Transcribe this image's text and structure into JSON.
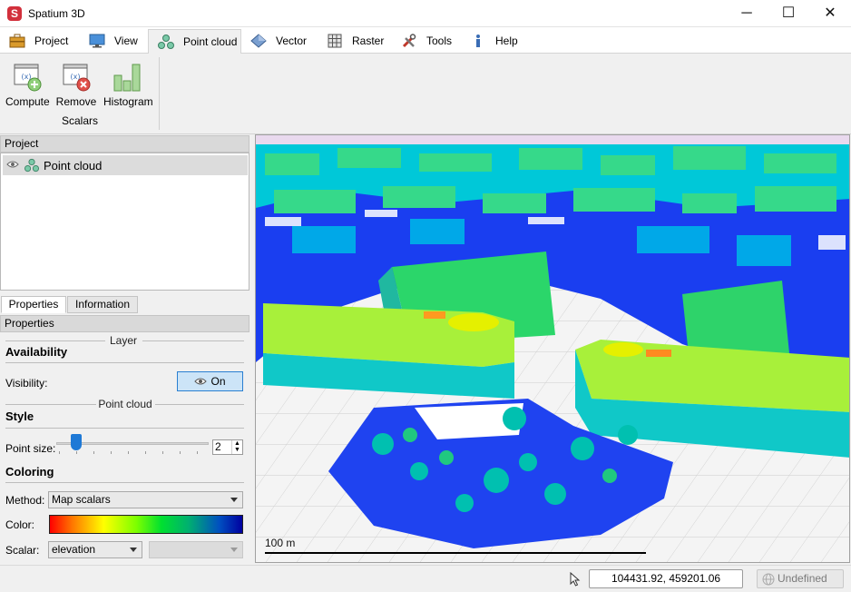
{
  "app": {
    "title": "Spatium 3D",
    "logo_letter": "S"
  },
  "window_controls": {
    "minimize": "─",
    "maximize": "☐",
    "close": "✕"
  },
  "tabs": [
    {
      "label": "Project",
      "icon": "briefcase-icon"
    },
    {
      "label": "View",
      "icon": "monitor-icon"
    },
    {
      "label": "Point cloud",
      "icon": "point-cloud-icon",
      "active": true
    },
    {
      "label": "Vector",
      "icon": "vector-diamond-icon"
    },
    {
      "label": "Raster",
      "icon": "raster-grid-icon"
    },
    {
      "label": "Tools",
      "icon": "tools-icon"
    },
    {
      "label": "Help",
      "icon": "info-icon"
    }
  ],
  "ribbon": {
    "buttons": [
      {
        "label": "Compute",
        "icon": "compute-scalar-icon"
      },
      {
        "label": "Remove",
        "icon": "remove-scalar-icon"
      },
      {
        "label": "Histogram",
        "icon": "histogram-icon"
      }
    ],
    "group_label": "Scalars"
  },
  "project_panel": {
    "header": "Project",
    "items": [
      {
        "label": "Point cloud",
        "visible": true
      }
    ]
  },
  "property_tabs": [
    {
      "label": "Properties",
      "active": true
    },
    {
      "label": "Information",
      "active": false
    }
  ],
  "properties": {
    "header": "Properties",
    "layer_caption": "Layer",
    "availability_head": "Availability",
    "visibility_label": "Visibility:",
    "visibility_button": "On",
    "pointcloud_caption": "Point cloud",
    "style_head": "Style",
    "point_size_label": "Point size:",
    "point_size_value": "2",
    "coloring_head": "Coloring",
    "method_label": "Method:",
    "method_value": "Map scalars",
    "color_label": "Color:",
    "scalar_label": "Scalar:",
    "scalar_value": "elevation",
    "scalar_secondary_value": ""
  },
  "viewport": {
    "scale_label": "100 m"
  },
  "statusbar": {
    "coordinates": "104431.92, 459201.06",
    "crs": "Undefined"
  }
}
